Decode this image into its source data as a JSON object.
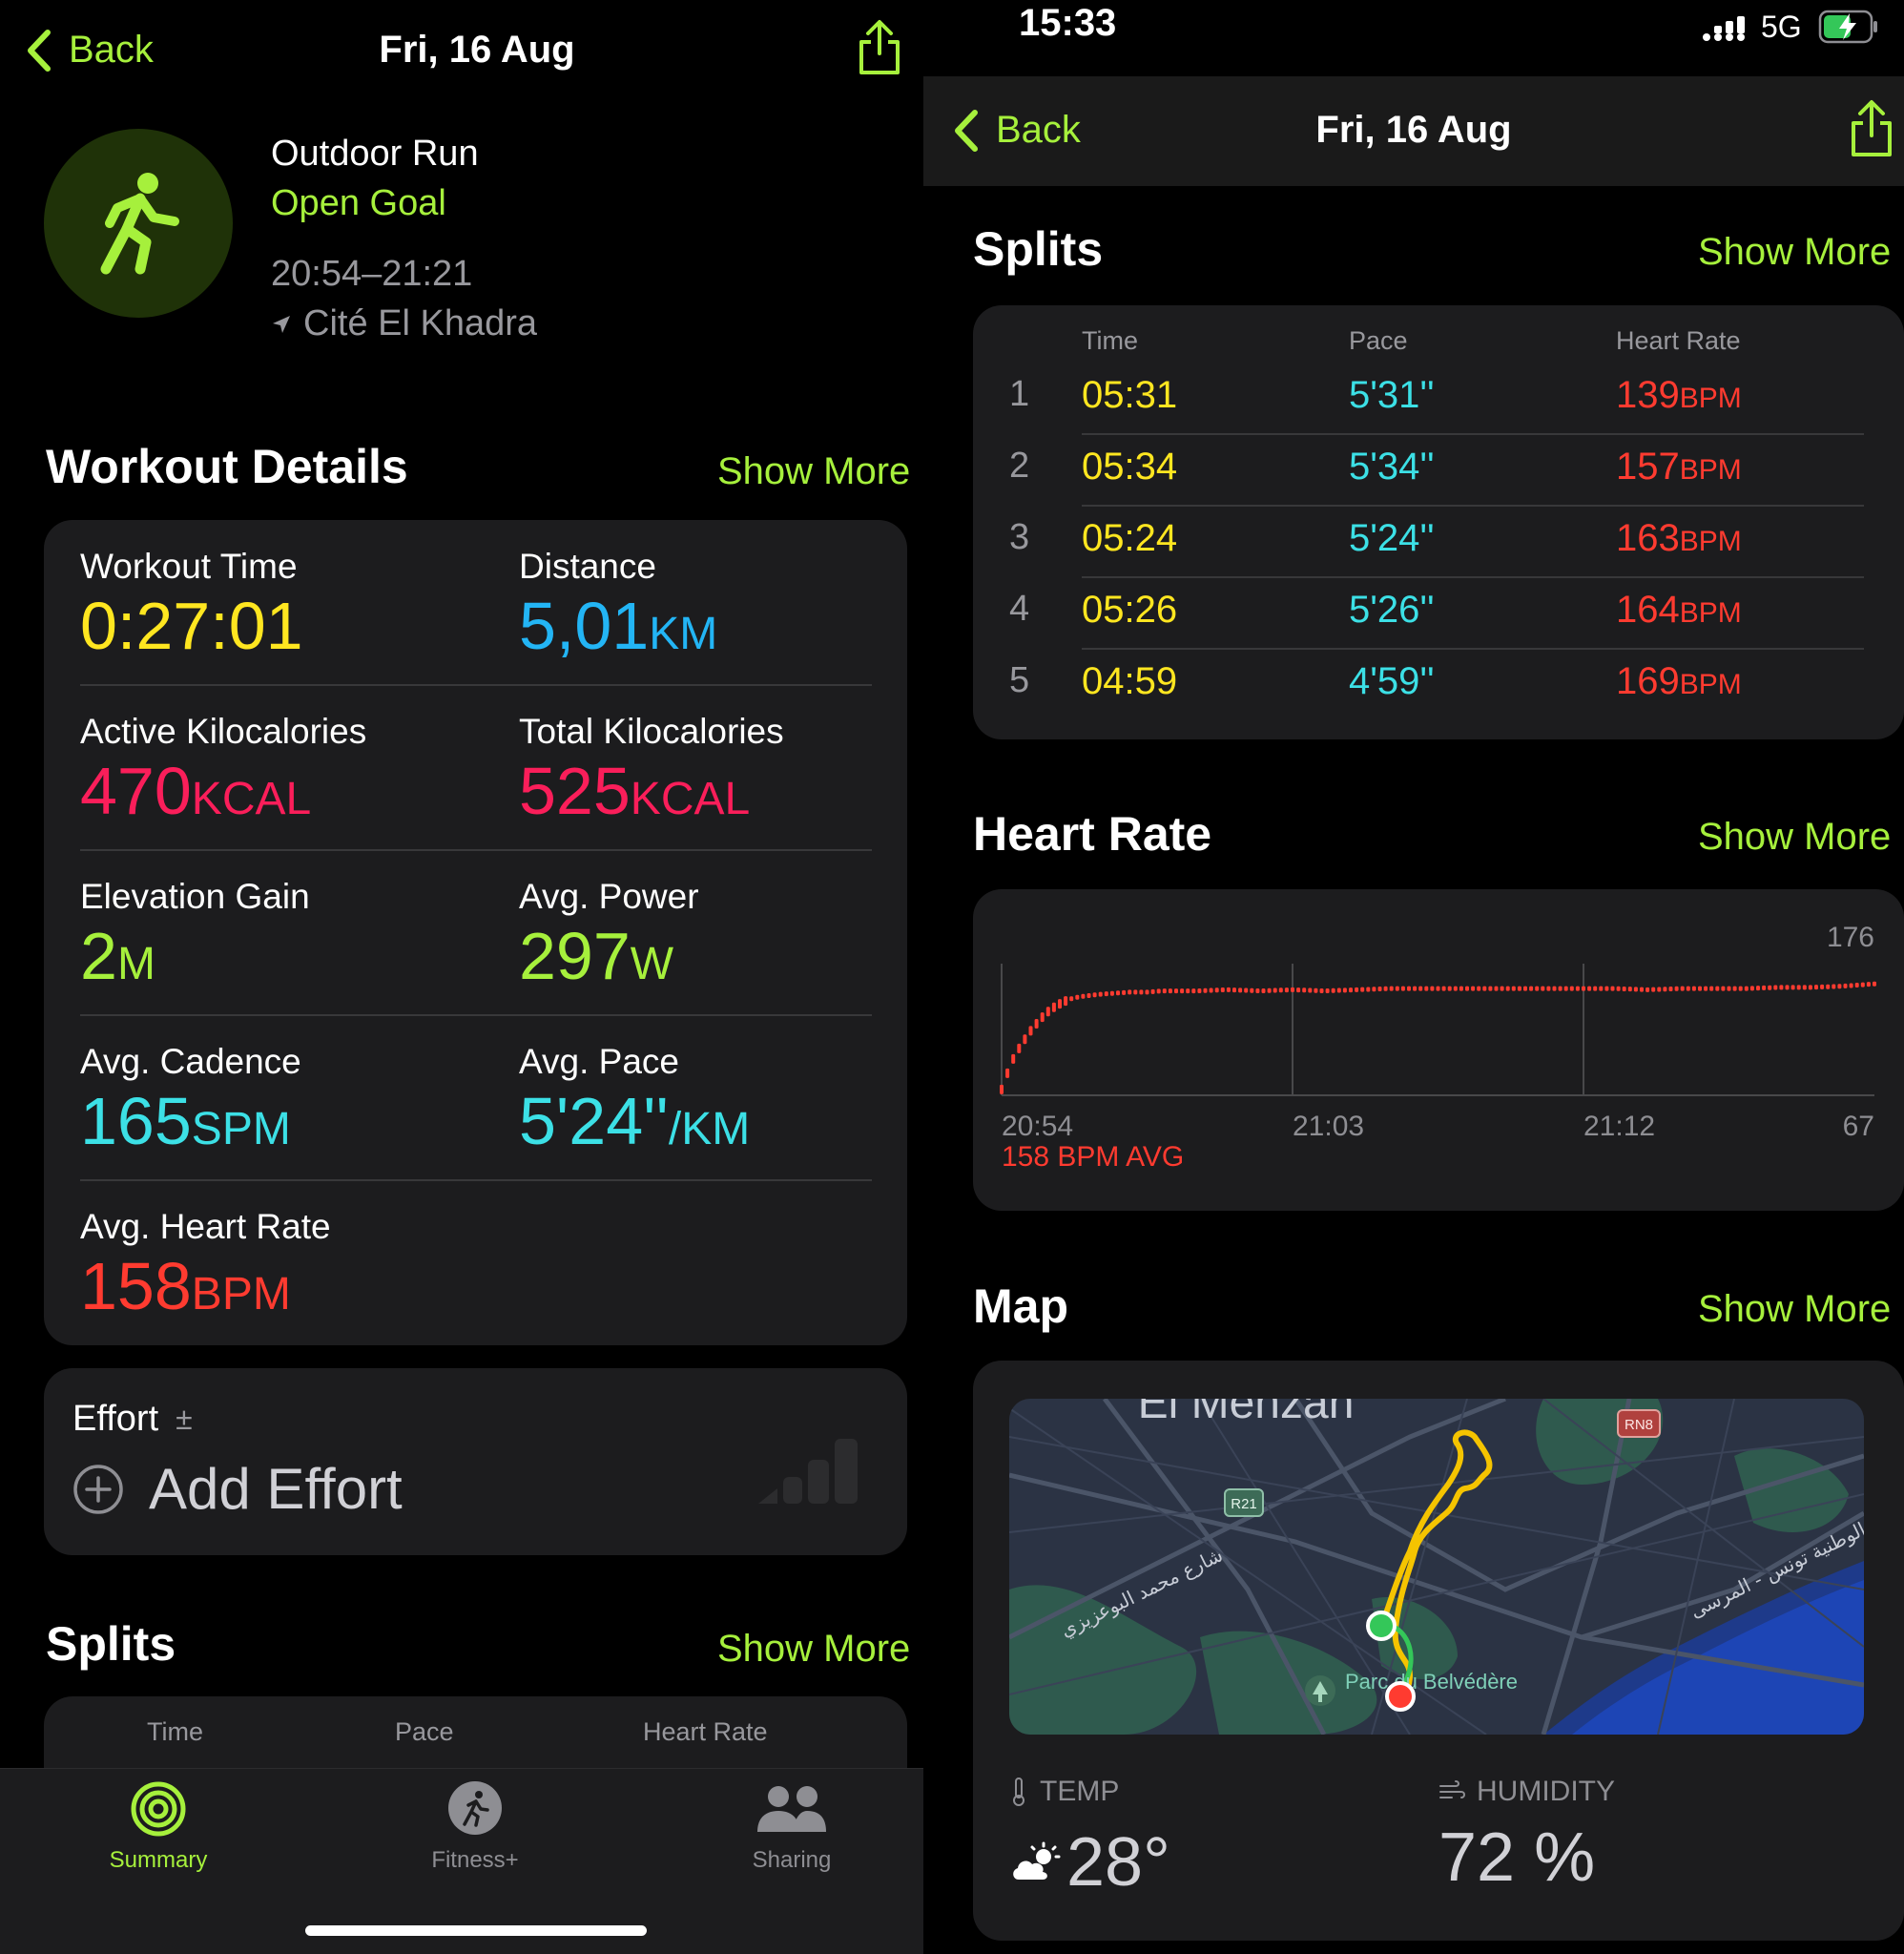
{
  "left": {
    "nav": {
      "back": "Back",
      "title": "Fri, 16 Aug"
    },
    "header": {
      "workout": "Outdoor Run",
      "goal": "Open Goal",
      "time": "20:54–21:21",
      "location": "Cité El Khadra"
    },
    "details": {
      "title": "Workout Details",
      "show_more": "Show More",
      "metrics": [
        {
          "label": "Workout Time",
          "value": "0:27:01",
          "unit": "",
          "color": "#ffe620"
        },
        {
          "label": "Distance",
          "value": "5,01",
          "unit": "KM",
          "color": "#23b5f5"
        },
        {
          "label": "Active Kilocalories",
          "value": "470",
          "unit": "KCAL",
          "color": "#fa1e5a"
        },
        {
          "label": "Total Kilocalories",
          "value": "525",
          "unit": "KCAL",
          "color": "#fa1e5a"
        },
        {
          "label": "Elevation Gain",
          "value": "2",
          "unit": "M",
          "color": "#a6f03c"
        },
        {
          "label": "Avg. Power",
          "value": "297",
          "unit": "W",
          "color": "#a6f03c"
        },
        {
          "label": "Avg. Cadence",
          "value": "165",
          "unit": "SPM",
          "color": "#3ce0e6"
        },
        {
          "label": "Avg. Pace",
          "value": "5'24''",
          "unit": "/KM",
          "color": "#3ce0e6"
        },
        {
          "label": "Avg. Heart Rate",
          "value": "158",
          "unit": "BPM",
          "color": "#ff3b30"
        }
      ]
    },
    "effort": {
      "label": "Effort",
      "symbol": "±",
      "add": "Add Effort"
    },
    "splits": {
      "title": "Splits",
      "show_more": "Show More",
      "columns": [
        "Time",
        "Pace",
        "Heart Rate"
      ]
    },
    "tabs": [
      {
        "label": "Summary"
      },
      {
        "label": "Fitness+"
      },
      {
        "label": "Sharing"
      }
    ]
  },
  "right": {
    "status": {
      "time": "15:33",
      "network": "5G"
    },
    "nav": {
      "back": "Back",
      "title": "Fri, 16 Aug"
    },
    "splits": {
      "title": "Splits",
      "show_more": "Show More",
      "columns": [
        "Time",
        "Pace",
        "Heart Rate"
      ],
      "rows": [
        {
          "n": "1",
          "time": "05:31",
          "pace": "5'31''",
          "hr": "139",
          "unit": "BPM"
        },
        {
          "n": "2",
          "time": "05:34",
          "pace": "5'34''",
          "hr": "157",
          "unit": "BPM"
        },
        {
          "n": "3",
          "time": "05:24",
          "pace": "5'24''",
          "hr": "163",
          "unit": "BPM"
        },
        {
          "n": "4",
          "time": "05:26",
          "pace": "5'26''",
          "hr": "164",
          "unit": "BPM"
        },
        {
          "n": "5",
          "time": "04:59",
          "pace": "4'59''",
          "hr": "169",
          "unit": "BPM"
        }
      ]
    },
    "heart_rate": {
      "title": "Heart Rate",
      "show_more": "Show More",
      "avg_label": "158 BPM AVG"
    },
    "map": {
      "title": "Map",
      "show_more": "Show More",
      "labels": {
        "district": "El Menzah",
        "road1": "RN8",
        "road2": "R21",
        "street_left": "شارع محمد البوعزيزي",
        "street_right": "الوطنية تونس - المرسى",
        "park": "Parc du Belvédère"
      }
    },
    "weather": {
      "temp_label": "TEMP",
      "temp_value": "28°",
      "humidity_label": "HUMIDITY",
      "humidity_value": "72 %"
    }
  },
  "chart_data": {
    "type": "scatter",
    "title": "",
    "x_ticks": [
      "20:54",
      "21:03",
      "21:12"
    ],
    "ylim": [
      67,
      176
    ],
    "y_labels": [
      "176",
      "67"
    ],
    "x_minutes": [
      0,
      0.3,
      0.6,
      0.9,
      1.2,
      1.5,
      1.8,
      2.1,
      2.4,
      2.7,
      3.0,
      3.5,
      4,
      4.5,
      5,
      6,
      7,
      8,
      9,
      10,
      11,
      12,
      13,
      14,
      15,
      16,
      17,
      18,
      19,
      20,
      21,
      22,
      23,
      24,
      25,
      26,
      27
    ],
    "values": [
      72,
      95,
      110,
      122,
      132,
      140,
      145,
      149,
      151,
      152,
      153,
      154,
      155,
      155,
      156,
      156,
      157,
      156,
      157,
      156,
      157,
      158,
      158,
      158,
      158,
      158,
      158,
      158,
      158,
      157,
      158,
      158,
      158,
      159,
      159,
      160,
      162
    ],
    "color": "#ff3b30"
  }
}
